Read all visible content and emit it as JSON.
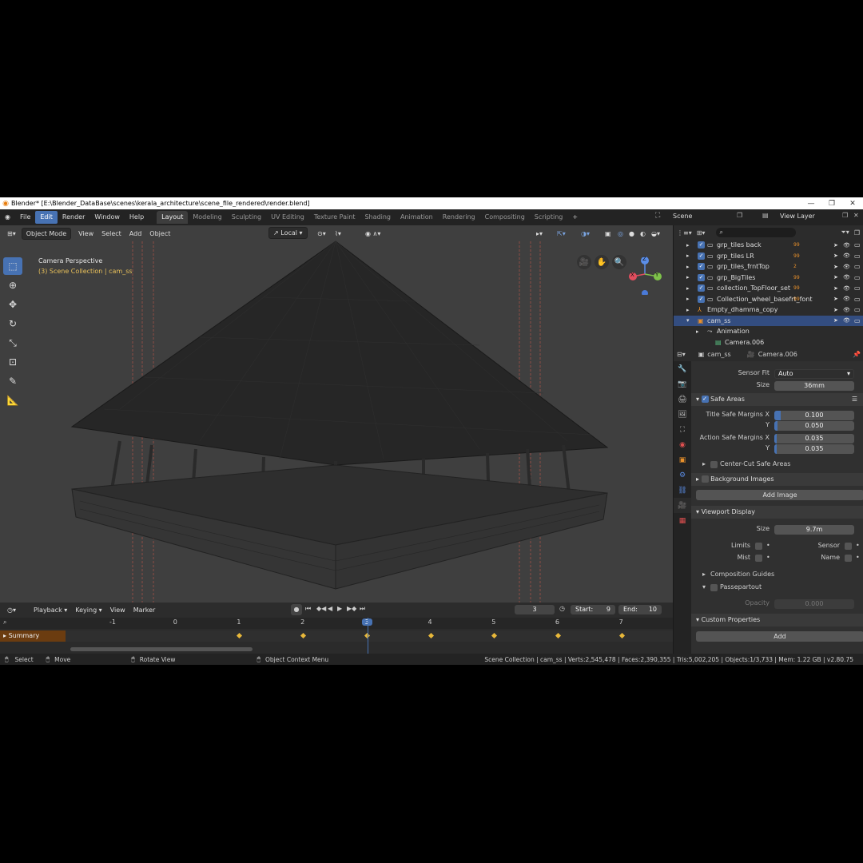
{
  "window": {
    "title": "Blender* [E:\\Blender_DataBase\\scenes\\kerala_architecture\\scene_file_rendered\\render.blend]",
    "minimize": "—",
    "maximize": "❐",
    "close": "✕"
  },
  "menu": {
    "items": [
      "File",
      "Edit",
      "Render",
      "Window",
      "Help"
    ],
    "active": "Edit"
  },
  "workspaces": {
    "tabs": [
      "Layout",
      "Modeling",
      "Sculpting",
      "UV Editing",
      "Texture Paint",
      "Shading",
      "Animation",
      "Rendering",
      "Compositing",
      "Scripting"
    ],
    "active": "Layout",
    "add": "+"
  },
  "scene": {
    "name": "Scene",
    "view_layer": "View Layer"
  },
  "viewport": {
    "mode": "Object Mode",
    "menus": [
      "View",
      "Select",
      "Add",
      "Object"
    ],
    "orientation": "Local",
    "overlay_title": "Camera Perspective",
    "overlay_subtitle": "(3) Scene Collection | cam_ss",
    "gizmo": {
      "z": "Z",
      "y": "Y",
      "x": "X"
    }
  },
  "timeline": {
    "menus": [
      "Playback",
      "Keying",
      "View",
      "Marker"
    ],
    "current_frame": "3",
    "start_label": "Start:",
    "start": "9",
    "end_label": "End:",
    "end": "10",
    "ruler": [
      "-1",
      "0",
      "1",
      "2",
      "3",
      "4",
      "5",
      "6",
      "7"
    ],
    "keyframes": [
      "1",
      "2",
      "3",
      "4",
      "5",
      "6",
      "7"
    ],
    "summary_label": "Summary"
  },
  "statusbar": {
    "select": "Select",
    "move": "Move",
    "rotate": "Rotate View",
    "context": "Object Context Menu",
    "stats": "Scene Collection | cam_ss | Verts:2,545,478 | Faces:2,390,355 | Tris:5,002,205 | Objects:1/3,733 | Mem: 1.22 GB | v2.80.75"
  },
  "outliner": {
    "rows": [
      {
        "label": "grp_tiles back",
        "extra": "99"
      },
      {
        "label": "grp_tiles LR",
        "extra": "99"
      },
      {
        "label": "grp_tiles_frntTop",
        "extra": "2"
      },
      {
        "label": "grp_BigTiles",
        "extra": "99"
      },
      {
        "label": "collection_TopFloor_set",
        "extra": "99"
      },
      {
        "label": "Collection_wheel_basefrt_font",
        "extra": "99"
      },
      {
        "label": "Empty_dhamma_copy",
        "extra": ""
      },
      {
        "label": "cam_ss",
        "extra": ""
      },
      {
        "label": "Animation",
        "extra": ""
      },
      {
        "label": "Camera.006",
        "extra": ""
      }
    ]
  },
  "properties": {
    "breadcrumb_object": "cam_ss",
    "breadcrumb_data": "Camera.006",
    "sensor_fit_label": "Sensor Fit",
    "sensor_fit": "Auto",
    "size_label": "Size",
    "size": "36mm",
    "safe_areas": "Safe Areas",
    "title_safe_x_label": "Title Safe Margins X",
    "title_safe_x": "0.100",
    "title_safe_x_fill": 0.1,
    "y_label": "Y",
    "title_safe_y": "0.050",
    "title_safe_y_fill": 0.05,
    "action_safe_x_label": "Action Safe Margins X",
    "action_safe_x": "0.035",
    "action_safe_x_fill": 0.035,
    "action_safe_y": "0.035",
    "action_safe_y_fill": 0.035,
    "center_cut": "Center-Cut Safe Areas",
    "background_images": "Background Images",
    "add_image": "Add Image",
    "viewport_display": "Viewport Display",
    "vd_size_label": "Size",
    "vd_size": "9.7m",
    "limits": "Limits",
    "sensor": "Sensor",
    "mist": "Mist",
    "name": "Name",
    "composition_guides": "Composition Guides",
    "passepartout": "Passepartout",
    "opacity_label": "Opacity",
    "opacity": "0.000",
    "custom_properties": "Custom Properties",
    "add": "Add"
  },
  "colors": {
    "accent": "#4772b3",
    "selected_row": "#334d80",
    "object_orange": "#e8902b",
    "keyframe": "#e8b83a"
  }
}
